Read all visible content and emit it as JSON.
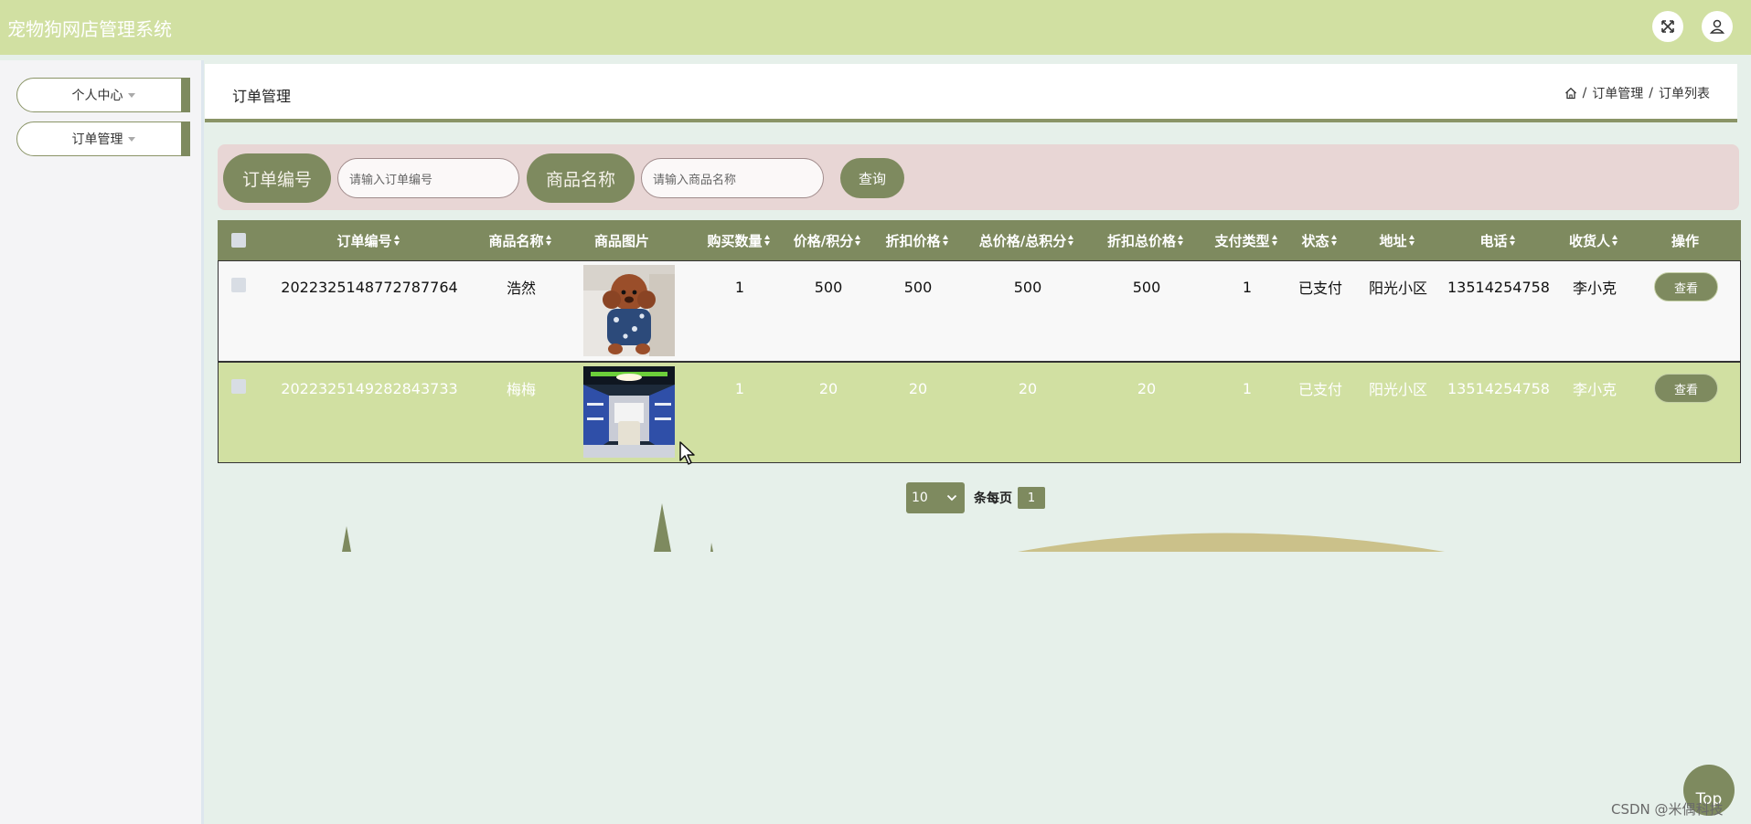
{
  "app": {
    "title": "宠物狗网店管理系统"
  },
  "topbar": {
    "fullscreen_icon": "expand-icon",
    "user_icon": "user-icon"
  },
  "sidebar": {
    "items": [
      {
        "label": "个人中心"
      },
      {
        "label": "订单管理"
      }
    ]
  },
  "header": {
    "title": "订单管理",
    "breadcrumb": [
      "订单管理",
      "订单列表"
    ],
    "separator": "/"
  },
  "search": {
    "order_label": "订单编号",
    "order_placeholder": "请输入订单编号",
    "product_label": "商品名称",
    "product_placeholder": "请输入商品名称",
    "query_label": "查询"
  },
  "table": {
    "columns": [
      "订单编号",
      "商品名称",
      "商品图片",
      "购买数量",
      "价格/积分",
      "折扣价格",
      "总价格/总积分",
      "折扣总价格",
      "支付类型",
      "状态",
      "地址",
      "电话",
      "收货人",
      "操作"
    ],
    "rows": [
      {
        "order_no": "2022325148772787764",
        "name": "浩然",
        "qty": "1",
        "price": "500",
        "discount": "500",
        "total": "500",
        "discount_total": "500",
        "pay_type": "1",
        "status": "已支付",
        "address": "阳光小区",
        "phone": "13514254758",
        "receiver": "李小克",
        "action": "查看"
      },
      {
        "order_no": "2022325149282843733",
        "name": "梅梅",
        "qty": "1",
        "price": "20",
        "discount": "20",
        "total": "20",
        "discount_total": "20",
        "pay_type": "1",
        "status": "已支付",
        "address": "阳光小区",
        "phone": "13514254758",
        "receiver": "李小克",
        "action": "查看"
      }
    ]
  },
  "pager": {
    "page_size": "10",
    "per_page_text": "条每页",
    "current_page": "1"
  },
  "colors": {
    "olive": "#7e8a5f",
    "topbar": "#d1e0a2",
    "search_bg": "#e8d6d5",
    "selected_row": "#d1e0a2"
  },
  "top_button": {
    "label": "Top"
  },
  "watermark": {
    "text": "CSDN @米偶科技"
  }
}
